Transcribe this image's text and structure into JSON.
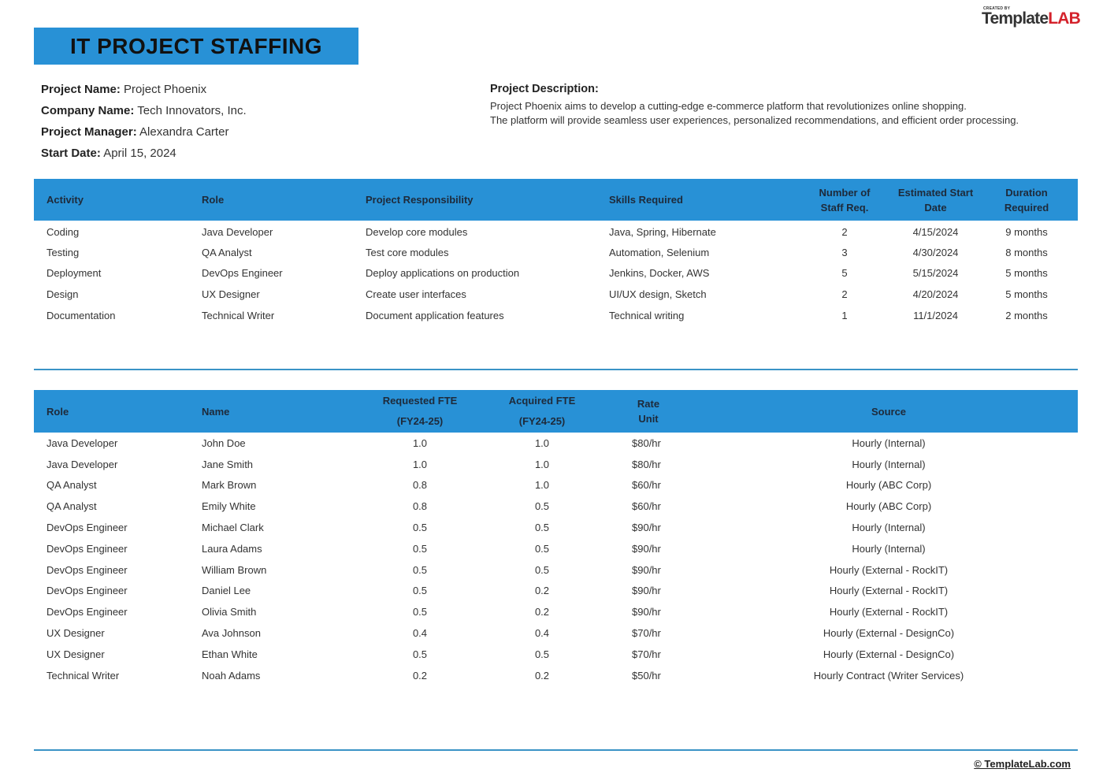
{
  "logo": {
    "created_by": "CREATED BY",
    "brand_main": "Template",
    "brand_accent": "LAB"
  },
  "title": "IT PROJECT STAFFING",
  "project_info": [
    {
      "label": "Project Name:",
      "value": "Project Phoenix"
    },
    {
      "label": "Company Name:",
      "value": "Tech Innovators, Inc."
    },
    {
      "label": "Project Manager:",
      "value": "Alexandra Carter"
    },
    {
      "label": "Start Date:",
      "value": "April 15, 2024"
    }
  ],
  "description": {
    "label": "Project Description:",
    "lines": [
      "Project Phoenix aims to develop a cutting-edge e-commerce platform that revolutionizes online shopping.",
      "The platform will provide seamless user experiences, personalized recommendations, and efficient order processing."
    ]
  },
  "activities_table": {
    "headers": [
      "Activity",
      "Role",
      "Project Responsibility",
      "Skills Required",
      [
        "Number of",
        "Staff Req."
      ],
      [
        "Estimated Start",
        "Date"
      ],
      [
        "Duration",
        "Required"
      ]
    ],
    "rows": [
      [
        "Coding",
        "Java Developer",
        "Develop core modules",
        "Java, Spring, Hibernate",
        "2",
        "4/15/2024",
        "9 months"
      ],
      [
        "Testing",
        "QA Analyst",
        "Test core modules",
        "Automation, Selenium",
        "3",
        "4/30/2024",
        "8 months"
      ],
      [
        "Deployment",
        "DevOps Engineer",
        "Deploy applications on production",
        "Jenkins, Docker, AWS",
        "5",
        "5/15/2024",
        "5 months"
      ],
      [
        "Design",
        "UX Designer",
        "Create user interfaces",
        "UI/UX design, Sketch",
        "2",
        "4/20/2024",
        "5 months"
      ],
      [
        "Documentation",
        "Technical Writer",
        "Document application features",
        "Technical writing",
        "1",
        "11/1/2024",
        "2 months"
      ]
    ]
  },
  "staff_table": {
    "headers": [
      "Role",
      "Name",
      [
        "Requested FTE",
        "(FY24-25)"
      ],
      [
        "Acquired FTE",
        "(FY24-25)"
      ],
      [
        "Rate",
        "Unit"
      ],
      "Source"
    ],
    "rows": [
      [
        "Java Developer",
        "John Doe",
        "1.0",
        "1.0",
        "$80/hr",
        "Hourly (Internal)"
      ],
      [
        "Java Developer",
        "Jane Smith",
        "1.0",
        "1.0",
        "$80/hr",
        "Hourly (Internal)"
      ],
      [
        "QA Analyst",
        "Mark Brown",
        "0.8",
        "1.0",
        "$60/hr",
        "Hourly (ABC Corp)"
      ],
      [
        "QA Analyst",
        "Emily White",
        "0.8",
        "0.5",
        "$60/hr",
        "Hourly (ABC Corp)"
      ],
      [
        "DevOps Engineer",
        "Michael Clark",
        "0.5",
        "0.5",
        "$90/hr",
        "Hourly (Internal)"
      ],
      [
        "DevOps Engineer",
        "Laura Adams",
        "0.5",
        "0.5",
        "$90/hr",
        "Hourly (Internal)"
      ],
      [
        "DevOps Engineer",
        "William Brown",
        "0.5",
        "0.5",
        "$90/hr",
        "Hourly (External - RockIT)"
      ],
      [
        "DevOps Engineer",
        "Daniel Lee",
        "0.5",
        "0.2",
        "$90/hr",
        "Hourly (External - RockIT)"
      ],
      [
        "DevOps Engineer",
        "Olivia Smith",
        "0.5",
        "0.2",
        "$90/hr",
        "Hourly (External - RockIT)"
      ],
      [
        "UX Designer",
        "Ava Johnson",
        "0.4",
        "0.4",
        "$70/hr",
        "Hourly (External - DesignCo)"
      ],
      [
        "UX Designer",
        "Ethan White",
        "0.5",
        "0.5",
        "$70/hr",
        "Hourly (External - DesignCo)"
      ],
      [
        "Technical Writer",
        "Noah Adams",
        "0.2",
        "0.2",
        "$50/hr",
        "Hourly Contract (Writer Services)"
      ]
    ]
  },
  "footer": {
    "copyright": "© TemplateLab.com"
  },
  "colors": {
    "accent_blue": "#2891d6",
    "divider_blue": "#3a93c6",
    "logo_red": "#d4222b"
  }
}
